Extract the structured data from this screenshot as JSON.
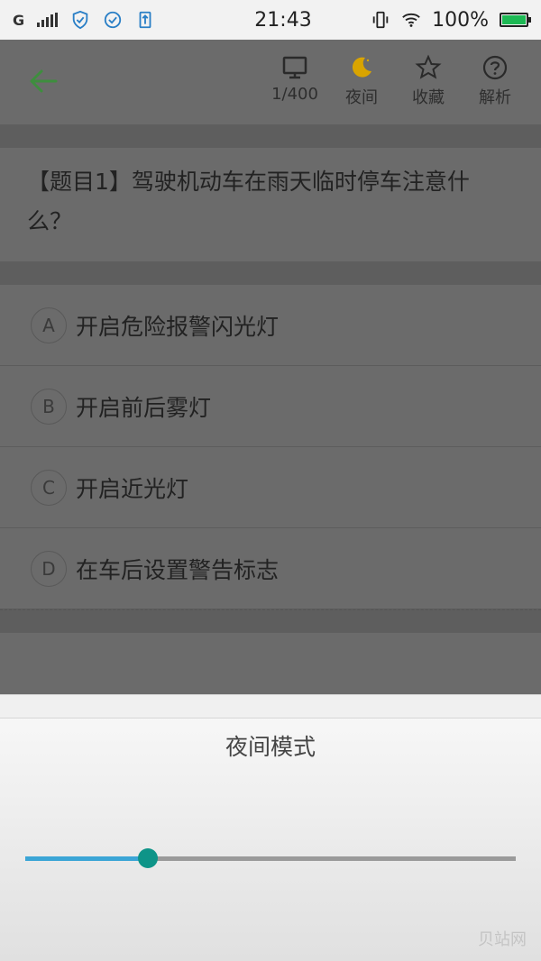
{
  "status_bar": {
    "network": "G",
    "time": "21:43",
    "battery": "100%"
  },
  "header": {
    "counter": "1/400",
    "night_label": "夜间",
    "favorite_label": "收藏",
    "analysis_label": "解析"
  },
  "question": {
    "text": "【题目1】驾驶机动车在雨天临时停车注意什么？"
  },
  "options": [
    {
      "letter": "A",
      "text": "开启危险报警闪光灯"
    },
    {
      "letter": "B",
      "text": "开启前后雾灯"
    },
    {
      "letter": "C",
      "text": "开启近光灯"
    },
    {
      "letter": "D",
      "text": "在车后设置警告标志"
    }
  ],
  "night_mode": {
    "title": "夜间模式",
    "brightness": 0.25
  },
  "watermark": "贝站网",
  "colors": {
    "back_arrow": "#3e8e3e",
    "moon": "#d9a400",
    "slider_fill": "#3ba5d6",
    "slider_thumb": "#0e9488",
    "battery": "#1db954"
  }
}
